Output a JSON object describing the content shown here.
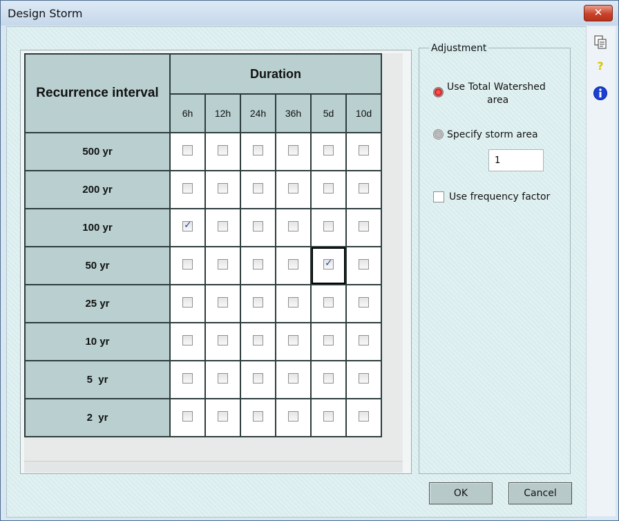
{
  "window": {
    "title": "Design Storm",
    "close_label": "✕"
  },
  "grid": {
    "row_header": "Recurrence interval",
    "duration_header": "Duration",
    "durations": [
      "6h",
      "12h",
      "24h",
      "36h",
      "5d",
      "10d"
    ],
    "rows": [
      {
        "label": "500 yr",
        "checked": [
          false,
          false,
          false,
          false,
          false,
          false
        ]
      },
      {
        "label": "200 yr",
        "checked": [
          false,
          false,
          false,
          false,
          false,
          false
        ]
      },
      {
        "label": "100 yr",
        "checked": [
          true,
          false,
          false,
          false,
          false,
          false
        ]
      },
      {
        "label": "50 yr",
        "checked": [
          false,
          false,
          false,
          false,
          true,
          false
        ]
      },
      {
        "label": "25 yr",
        "checked": [
          false,
          false,
          false,
          false,
          false,
          false
        ]
      },
      {
        "label": "10 yr",
        "checked": [
          false,
          false,
          false,
          false,
          false,
          false
        ]
      },
      {
        "label": "5  yr",
        "checked": [
          false,
          false,
          false,
          false,
          false,
          false
        ]
      },
      {
        "label": "2  yr",
        "checked": [
          false,
          false,
          false,
          false,
          false,
          false
        ]
      }
    ],
    "active_cell": {
      "row": 3,
      "col": 4
    }
  },
  "adjustment": {
    "legend": "Adjustment",
    "use_total_line1": "Use Total Watershed",
    "use_total_line2": "area",
    "specify_label": "Specify storm area",
    "storm_area_value": "1",
    "frequency_label": "Use frequency factor",
    "selected": "use_total",
    "frequency_checked": false
  },
  "buttons": {
    "ok": "OK",
    "cancel": "Cancel"
  },
  "sidebar_icons": [
    "copy-icon",
    "help-icon",
    "info-icon"
  ],
  "colors": {
    "header_bg": "#b9cfd0",
    "close_red": "#c9432b",
    "radio_on": "#d11"
  }
}
